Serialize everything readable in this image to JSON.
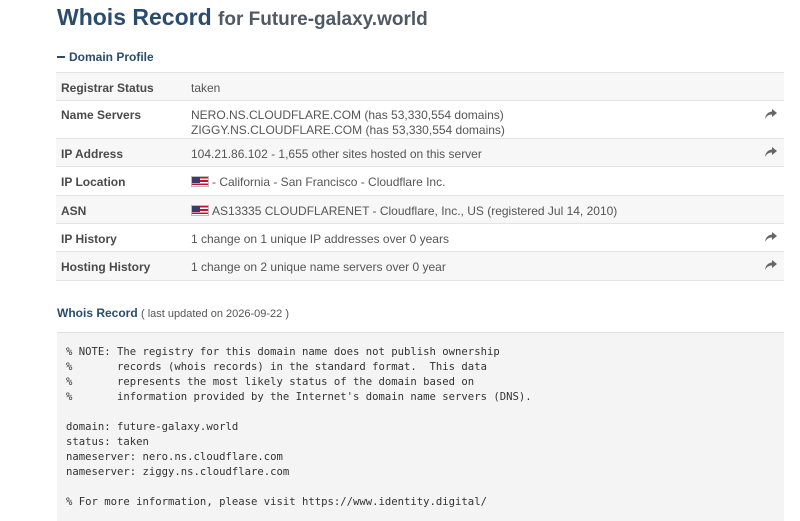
{
  "header": {
    "title_main": "Whois Record",
    "title_sub": "for Future-galaxy.world"
  },
  "section": {
    "toggle_label": "Domain Profile"
  },
  "profile": [
    {
      "label": "Registrar Status",
      "lines": [
        "taken"
      ],
      "share": false,
      "flag": false
    },
    {
      "label": "Name Servers",
      "lines": [
        "NERO.NS.CLOUDFLARE.COM (has 53,330,554 domains)",
        "ZIGGY.NS.CLOUDFLARE.COM (has 53,330,554 domains)"
      ],
      "share": true,
      "flag": false
    },
    {
      "label": "IP Address",
      "lines": [
        "104.21.86.102 - 1,655 other sites hosted on this server"
      ],
      "share": true,
      "flag": false
    },
    {
      "label": "IP Location",
      "lines": [
        "- California - San Francisco - Cloudflare Inc."
      ],
      "share": false,
      "flag": true
    },
    {
      "label": "ASN",
      "lines": [
        "AS13335 CLOUDFLARENET - Cloudflare, Inc., US (registered Jul 14, 2010)"
      ],
      "share": false,
      "flag": true
    },
    {
      "label": "IP History",
      "lines": [
        "1 change on 1 unique IP addresses over 0 years"
      ],
      "share": true,
      "flag": false
    },
    {
      "label": "Hosting History",
      "lines": [
        "1 change on 2 unique name servers over 0 year"
      ],
      "share": true,
      "flag": false
    }
  ],
  "whois": {
    "heading": "Whois Record",
    "updated": "( last updated on 2026-09-22 )",
    "raw": "% NOTE: The registry for this domain name does not publish ownership\n%       records (whois records) in the standard format.  This data\n%       represents the most likely status of the domain based on\n%       information provided by the Internet's domain name servers (DNS).\n\ndomain: future-galaxy.world\nstatus: taken\nnameserver: nero.ns.cloudflare.com\nnameserver: ziggy.ns.cloudflare.com\n\n% For more information, please visit https://www.identity.digital/"
  },
  "icons": {
    "share": "share-arrow-icon",
    "flag": "us-flag-icon"
  },
  "colors": {
    "title": "#2a4d6e",
    "row_alt": "#f7f7f7",
    "whois_bg": "#f4f4f4"
  }
}
